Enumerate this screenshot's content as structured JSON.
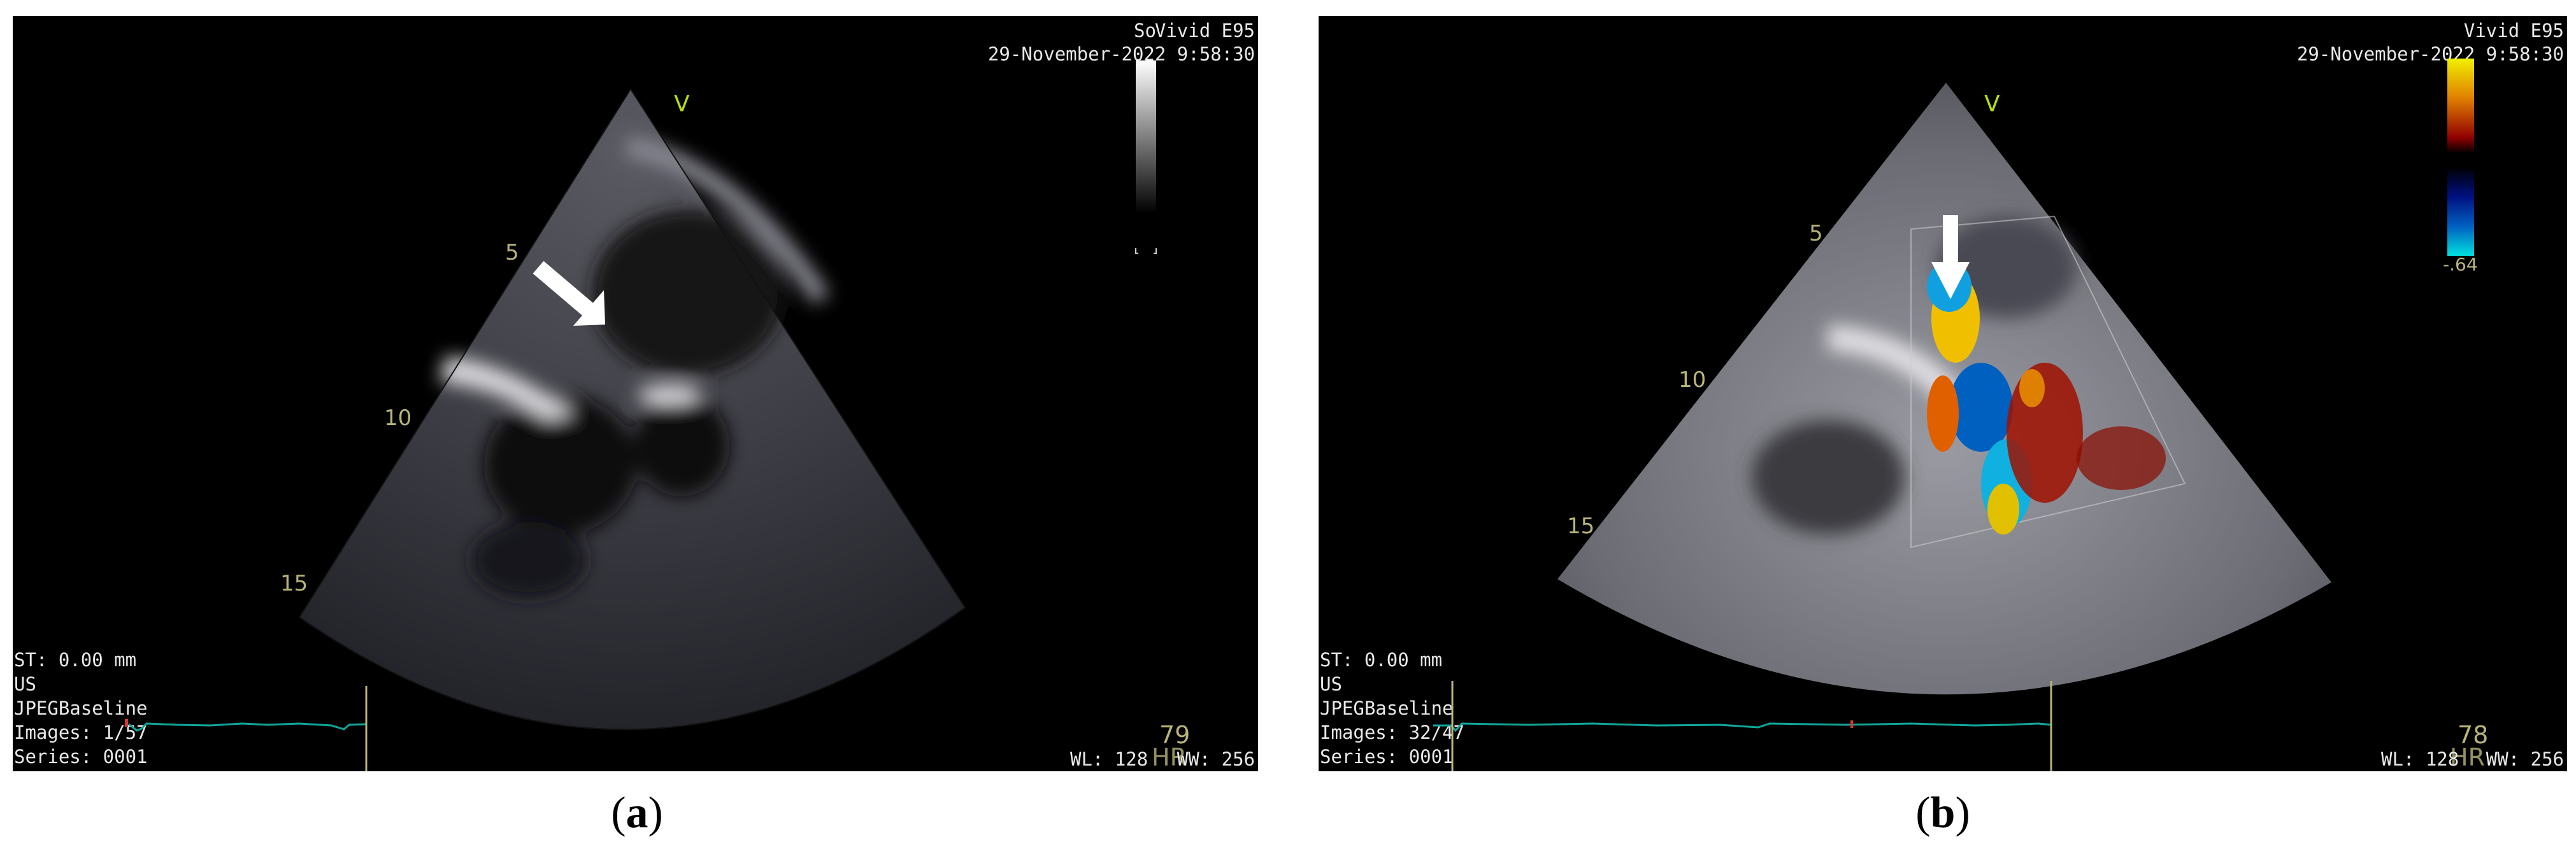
{
  "panels": [
    {
      "caption_letter": "a",
      "device": "Vivid E95",
      "overlap_label": "So",
      "datetime": "29-November-2022 9:58:30",
      "marker": "V",
      "depth_labels": [
        "5",
        "10",
        "15"
      ],
      "info": {
        "st": "ST: 0.00 mm",
        "modality": "US",
        "compression": "JPEGBaseline",
        "images": "Images: 1/57",
        "series": "Series: 0001"
      },
      "heart_rate": "79",
      "hr_label": "HR",
      "wl": "WL: 128",
      "ww": "WW: 256",
      "arrow_icon": "arrow-down-right"
    },
    {
      "caption_letter": "b",
      "device": "Vivid E95",
      "datetime": "29-November-2022 9:58:30",
      "marker": "V",
      "depth_labels": [
        "5",
        "10",
        "15"
      ],
      "color_scale_min": "-.64",
      "info": {
        "st": "ST: 0.00 mm",
        "modality": "US",
        "compression": "JPEGBaseline",
        "images": "Images: 32/47",
        "series": "Series: 0001"
      },
      "heart_rate": "78",
      "hr_label": "HR",
      "wl": "WL: 128",
      "ww": "WW: 256",
      "arrow_icon": "arrow-down"
    }
  ],
  "captions": {
    "open": "(",
    "close": ")"
  },
  "colors": {
    "ecg": "#10a89a",
    "depth": "#b9b57a",
    "marker": "#b8e000"
  }
}
